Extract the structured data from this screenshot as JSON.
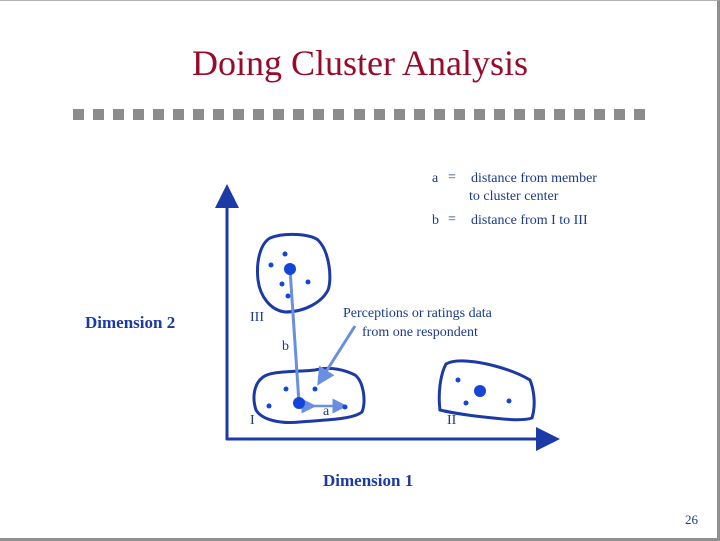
{
  "slide": {
    "title": "Doing Cluster Analysis",
    "page_number": "26",
    "divider_squares": 29
  },
  "legend": {
    "a_symbol": "a",
    "a_eq": "=",
    "a_text_line1": "distance from member",
    "a_text_line2": "to cluster center",
    "b_symbol": "b",
    "b_eq": "=",
    "b_text": "distance from I to III"
  },
  "diagram": {
    "x_axis_label": "Dimension 1",
    "y_axis_label": "Dimension 2",
    "clusters": [
      {
        "id": "I",
        "label": "I"
      },
      {
        "id": "II",
        "label": "II"
      },
      {
        "id": "III",
        "label": "III"
      }
    ],
    "distance_a_label": "a",
    "distance_b_label": "b",
    "annotation_line1": "Perceptions or ratings data",
    "annotation_line2": "from one respondent"
  },
  "colors": {
    "title": "#99092a",
    "axis": "#1c3aa6",
    "cluster_outline": "#1c3aa6",
    "point": "#1245d8",
    "connector": "#6a8fe0",
    "text": "#1d3a8a",
    "divider": "#8c8c8c"
  }
}
